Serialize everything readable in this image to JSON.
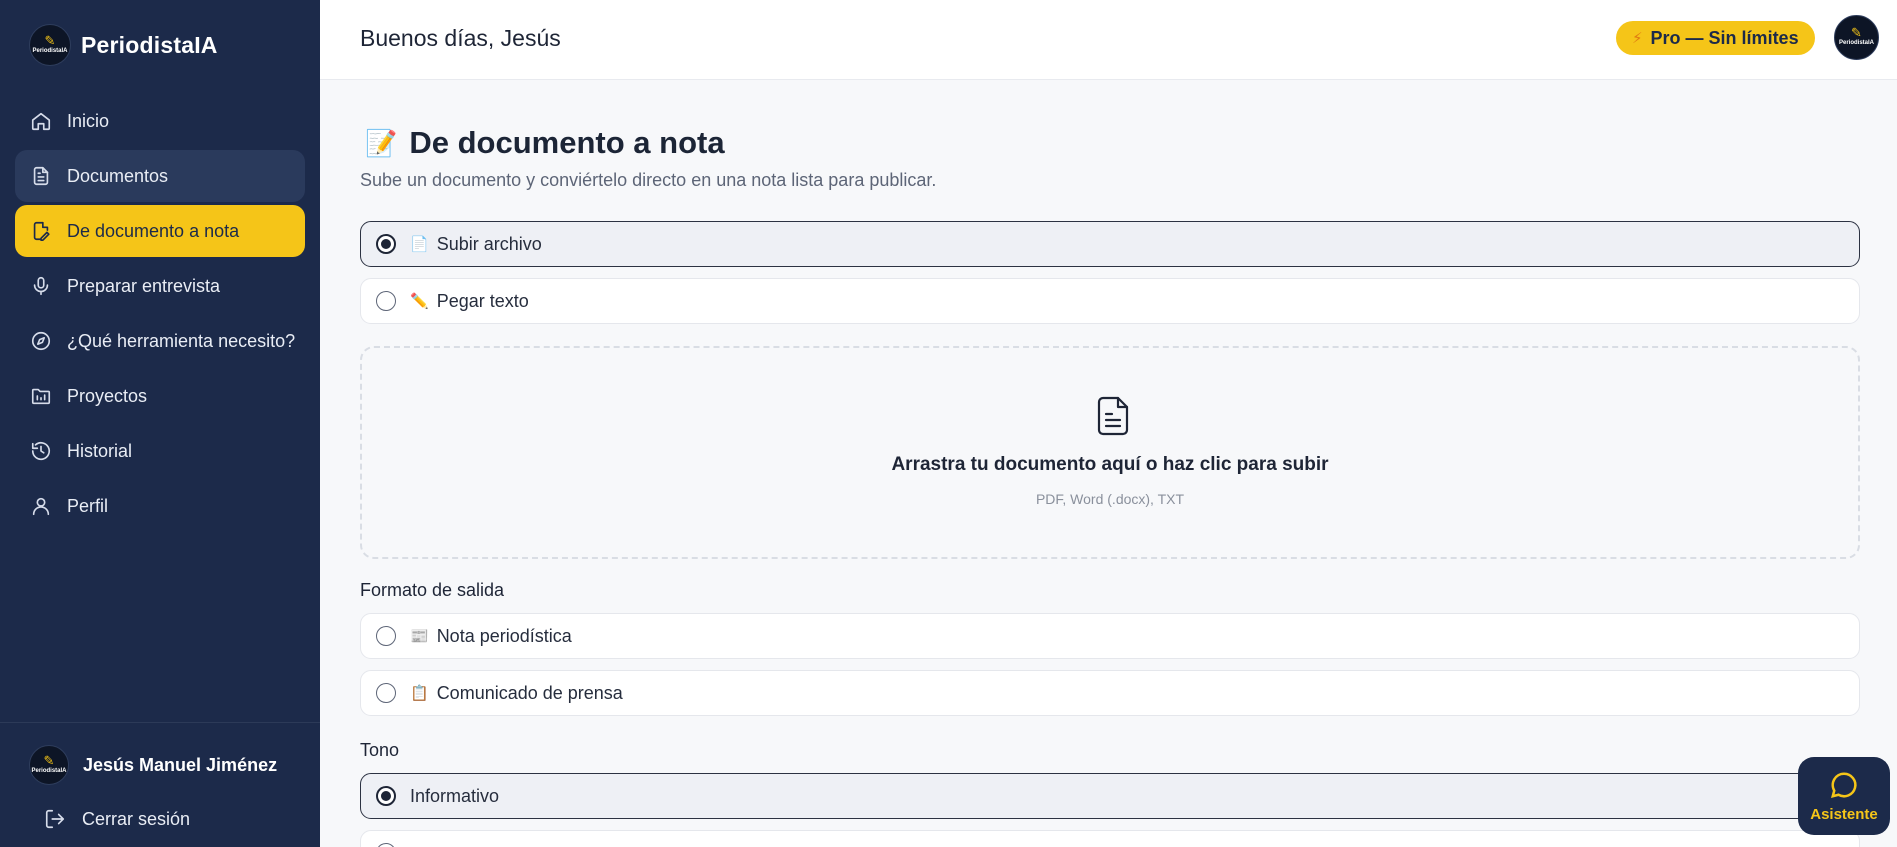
{
  "app": {
    "name": "PeriodistaIA",
    "logo_text": "PeriodistaIA"
  },
  "sidebar": {
    "items": [
      {
        "label": "Inicio",
        "icon": "home-icon"
      },
      {
        "label": "Documentos",
        "icon": "document-icon"
      },
      {
        "label": "De documento a nota",
        "icon": "file-edit-icon"
      },
      {
        "label": "Preparar entrevista",
        "icon": "microphone-icon"
      },
      {
        "label": "¿Qué herramienta necesito?",
        "icon": "compass-icon"
      },
      {
        "label": "Proyectos",
        "icon": "folder-icon"
      },
      {
        "label": "Historial",
        "icon": "history-icon"
      },
      {
        "label": "Perfil",
        "icon": "user-icon"
      }
    ],
    "user": {
      "name": "Jesús Manuel Jiménez"
    },
    "logout_label": "Cerrar sesión"
  },
  "topbar": {
    "greeting": "Buenos días, Jesús",
    "plan_badge": "Pro — Sin límites"
  },
  "page": {
    "title_emoji": "📝",
    "title": "De documento a nota",
    "subtitle": "Sube un documento y conviértelo directo en una nota lista para publicar.",
    "source_options": [
      {
        "emoji": "📄",
        "label": "Subir archivo",
        "selected": true
      },
      {
        "emoji": "✏️",
        "label": "Pegar texto",
        "selected": false
      }
    ],
    "dropzone": {
      "title": "Arrastra tu documento aquí o haz clic para subir",
      "hint": "PDF, Word (.docx), TXT"
    },
    "format_label": "Formato de salida",
    "format_options": [
      {
        "emoji": "📰",
        "label": "Nota periodística",
        "selected": false
      },
      {
        "emoji": "📋",
        "label": "Comunicado de prensa",
        "selected": false
      }
    ],
    "tone_label": "Tono",
    "tone_options": [
      {
        "label": "Informativo",
        "selected": true
      }
    ]
  },
  "assistant": {
    "label": "Asistente"
  },
  "colors": {
    "sidebar": "#1c2a4a",
    "accent": "#f5c518",
    "background": "#f7f8fa"
  }
}
